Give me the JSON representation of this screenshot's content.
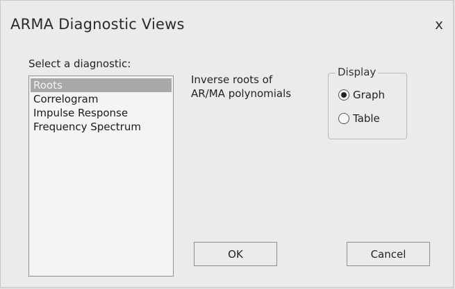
{
  "window": {
    "title": "ARMA Diagnostic Views",
    "close_glyph": "x"
  },
  "diagnostic": {
    "label": "Select a diagnostic:",
    "items": [
      "Roots",
      "Correlogram",
      "Impulse Response",
      "Frequency Spectrum"
    ],
    "selected_index": 0
  },
  "description": {
    "line1": "Inverse roots of",
    "line2": "AR/MA polynomials"
  },
  "display": {
    "legend": "Display",
    "options": [
      "Graph",
      "Table"
    ],
    "selected": "Graph"
  },
  "buttons": {
    "ok": "OK",
    "cancel": "Cancel"
  }
}
